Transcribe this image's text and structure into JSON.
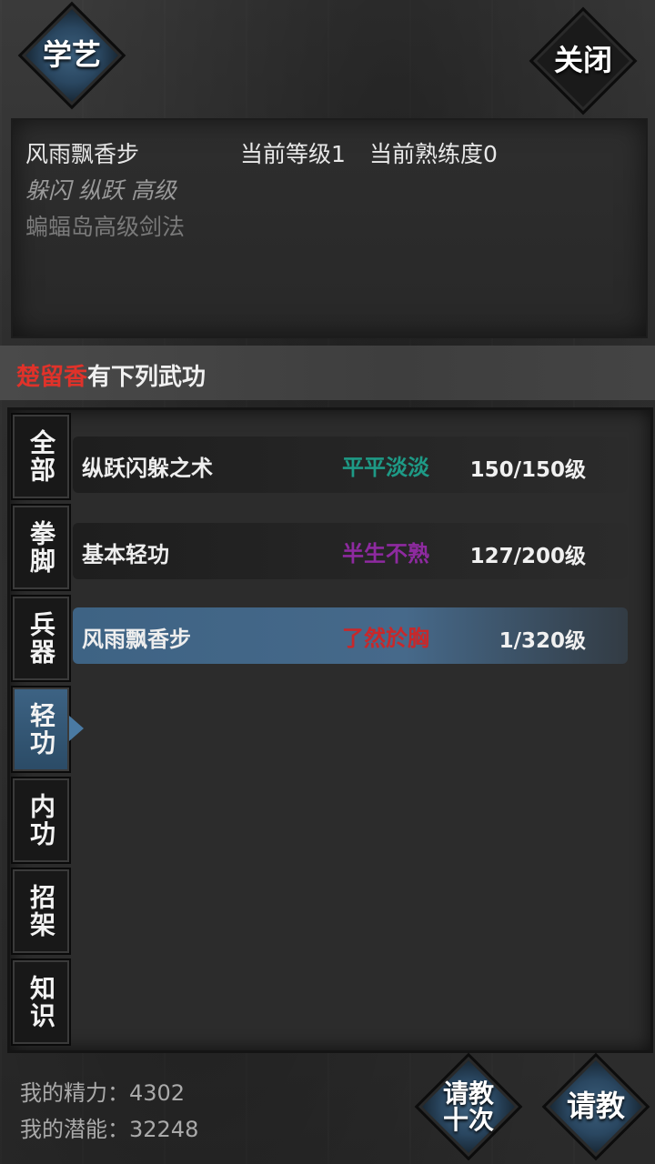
{
  "header": {
    "learn_label": "学艺",
    "close_label": "关闭"
  },
  "info": {
    "skill_name": "风雨飘香步",
    "current_level": "当前等级1",
    "current_proficiency": "当前熟练度0",
    "tags": "躲闪 纵跃 高级",
    "source": "蝙蝠岛高级剑法"
  },
  "banner": {
    "master_name": "楚留香",
    "suffix": "有下列武功",
    "master_color": "#e0322a"
  },
  "categories": [
    {
      "label": "全部"
    },
    {
      "label": "拳脚"
    },
    {
      "label": "兵器"
    },
    {
      "label": "轻功"
    },
    {
      "label": "内功"
    },
    {
      "label": "招架"
    },
    {
      "label": "知识"
    }
  ],
  "active_category": "轻功",
  "skills": [
    {
      "name": "纵跃闪躲之术",
      "grade": "平平淡淡",
      "grade_color": "#1e9a86",
      "level": "150/150级"
    },
    {
      "name": "基本轻功",
      "grade": "半生不熟",
      "grade_color": "#8e2aa0",
      "level": "127/200级"
    },
    {
      "name": "风雨飘香步",
      "grade": "了然於胸",
      "grade_color": "#c8282a",
      "level": "1/320级"
    }
  ],
  "stats": {
    "energy": "我的精力：4302",
    "potential": "我的潜能：32248"
  },
  "footer": {
    "teach_ten_label": "请教十次",
    "teach_label": "请教"
  }
}
